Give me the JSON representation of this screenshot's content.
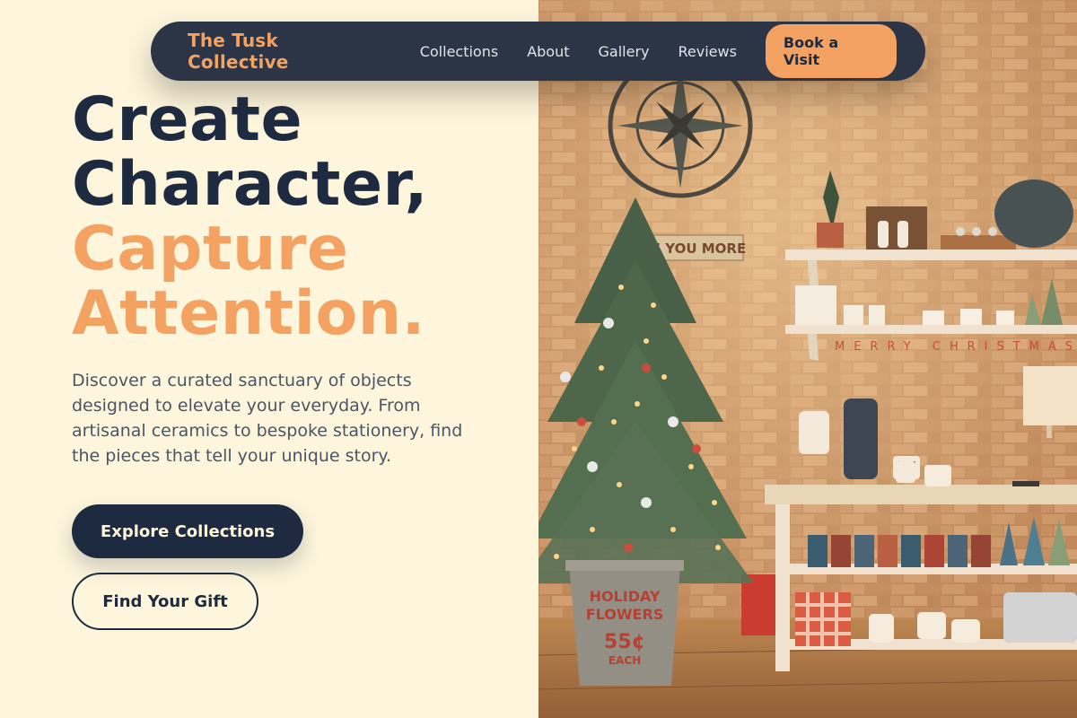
{
  "nav": {
    "brand": "The Tusk Collective",
    "links": [
      "Collections",
      "About",
      "Gallery",
      "Reviews"
    ],
    "cta": "Book a Visit"
  },
  "hero": {
    "headline_line1": "Create",
    "headline_line2": "Character,",
    "headline_accent1": "Capture",
    "headline_accent2": "Attention.",
    "lede": "Discover a curated sanctuary of objects designed to elevate your everyday. From artisanal ceramics to bespoke stationery, find the pieces that tell your unique story.",
    "primary_button": "Explore Collections",
    "secondary_button": "Find Your Gift"
  },
  "photo": {
    "sign_text": "LOVE YOU MORE",
    "bucket_line1": "HOLIDAY",
    "bucket_line2": "FLOWERS",
    "bucket_price": "55¢",
    "bucket_each": "EACH",
    "banner": "MERRY CHRISTMAS"
  },
  "colors": {
    "background": "#fdf6dc",
    "navy": "#1e2a3f",
    "accent": "#f4a261",
    "nav_bg": "#2b3546"
  }
}
